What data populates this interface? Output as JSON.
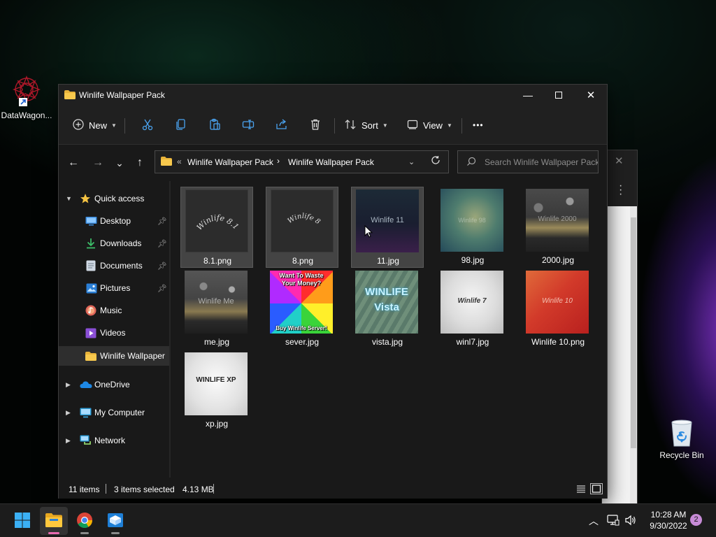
{
  "desktop": {
    "icons": [
      {
        "label": "DataWagon...",
        "icon": "datawagon-shortcut-icon"
      },
      {
        "label": "Recycle Bin",
        "icon": "recycle-bin-icon"
      }
    ]
  },
  "window": {
    "title": "Winlife Wallpaper Pack",
    "controls": {
      "minimize": "minimize-icon",
      "maximize": "maximize-icon",
      "close": "close-icon"
    }
  },
  "toolbar": {
    "new_label": "New",
    "sort_label": "Sort",
    "view_label": "View",
    "more_label": "•••",
    "icons": [
      "cut-icon",
      "copy-icon",
      "paste-icon",
      "rename-icon",
      "share-icon",
      "delete-icon"
    ]
  },
  "navigation": {
    "back": "←",
    "forward": "→",
    "recent": "⌄",
    "up": "↑"
  },
  "address": {
    "prefix": "«",
    "crumbs": [
      "Winlife Wallpaper Pack",
      "Winlife Wallpaper Pack"
    ],
    "separator": "›"
  },
  "search": {
    "placeholder": "Search Winlife Wallpaper Pack"
  },
  "sidebar": {
    "items": [
      {
        "label": "Quick access",
        "icon": "star-icon",
        "expanded": true,
        "pinned": false
      },
      {
        "label": "Desktop",
        "icon": "desktop-icon",
        "pinned": true
      },
      {
        "label": "Downloads",
        "icon": "downloads-icon",
        "pinned": true
      },
      {
        "label": "Documents",
        "icon": "documents-icon",
        "pinned": true
      },
      {
        "label": "Pictures",
        "icon": "pictures-icon",
        "pinned": true
      },
      {
        "label": "Music",
        "icon": "music-icon",
        "pinned": false
      },
      {
        "label": "Videos",
        "icon": "videos-icon",
        "pinned": false
      },
      {
        "label": "Winlife Wallpaper",
        "icon": "folder-icon",
        "pinned": false,
        "selected": true
      },
      {
        "label": "OneDrive",
        "icon": "onedrive-icon",
        "expanded": false
      },
      {
        "label": "My Computer",
        "icon": "computer-icon",
        "expanded": false
      },
      {
        "label": "Network",
        "icon": "network-icon",
        "expanded": false
      }
    ]
  },
  "files": [
    {
      "name": "8.1.png",
      "selected": true,
      "thumb_text": "Winlife 8.1"
    },
    {
      "name": "8.png",
      "selected": true,
      "thumb_text": "Winlife 8"
    },
    {
      "name": "11.jpg",
      "selected": true,
      "thumb_text": "Winlife 11"
    },
    {
      "name": "98.jpg",
      "selected": false,
      "thumb_text": "Winlife 98"
    },
    {
      "name": "2000.jpg",
      "selected": false,
      "thumb_text": "Winlife 2000"
    },
    {
      "name": "me.jpg",
      "selected": false,
      "thumb_text": "Winlife Me"
    },
    {
      "name": "sever.jpg",
      "selected": false,
      "thumb_text_top": "Want To Waste Your Money?",
      "thumb_text_bottom": "Buy Winlife Server!"
    },
    {
      "name": "vista.jpg",
      "selected": false,
      "thumb_text": "WINLIFE Vista"
    },
    {
      "name": "winl7.jpg",
      "selected": false,
      "thumb_text": "Winlife 7"
    },
    {
      "name": "Winlife 10.png",
      "selected": false,
      "thumb_text": "Winlife 10"
    },
    {
      "name": "xp.jpg",
      "selected": false,
      "thumb_text": "WINLIFE XP"
    }
  ],
  "status": {
    "item_count": "11 items",
    "selection": "3 items selected",
    "size": "4.13 MB"
  },
  "taskbar": {
    "apps": [
      {
        "name": "start",
        "icon": "windows-start-icon"
      },
      {
        "name": "file-explorer",
        "icon": "file-explorer-icon",
        "active": true
      },
      {
        "name": "chrome",
        "icon": "chrome-icon"
      },
      {
        "name": "app",
        "icon": "box-app-icon"
      }
    ],
    "tray": {
      "chevron": "^",
      "time": "10:28 AM",
      "date": "9/30/2022",
      "notifications": "2"
    }
  }
}
